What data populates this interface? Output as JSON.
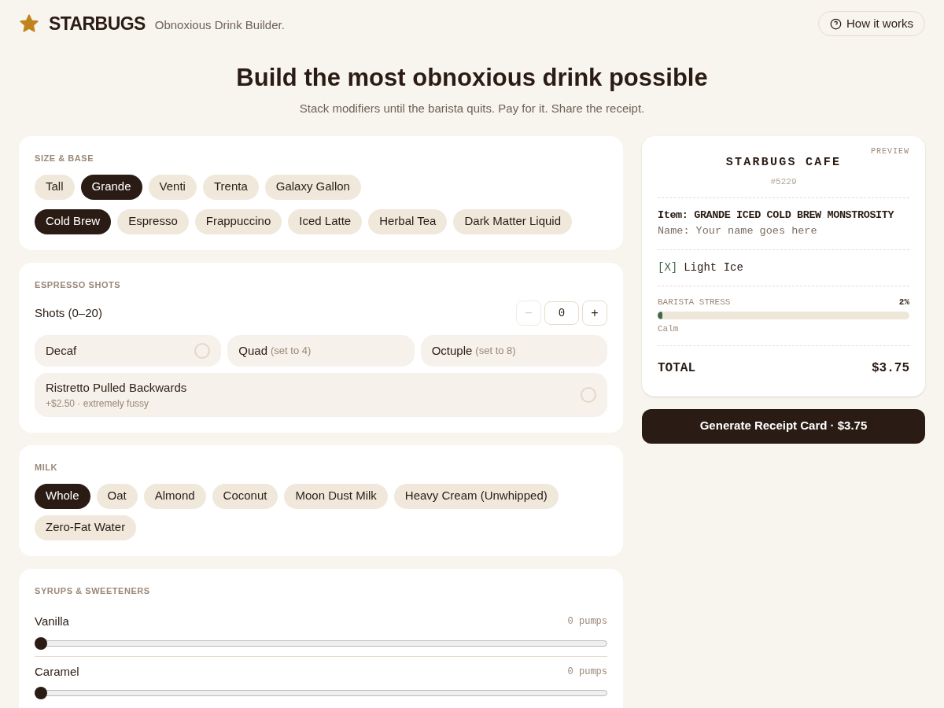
{
  "brand": {
    "name": "STARBUGS",
    "tagline": "Obnoxious Drink Builder."
  },
  "help_button": {
    "label": "How it works"
  },
  "hero": {
    "title": "Build the most obnoxious drink possible",
    "subtitle": "Stack modifiers until the barista quits. Pay for it. Share the receipt."
  },
  "size_base": {
    "heading": "SIZE & BASE",
    "sizes": [
      {
        "label": "Tall",
        "selected": false
      },
      {
        "label": "Grande",
        "selected": true
      },
      {
        "label": "Venti",
        "selected": false
      },
      {
        "label": "Trenta",
        "selected": false
      },
      {
        "label": "Galaxy Gallon",
        "selected": false
      }
    ],
    "bases": [
      {
        "label": "Cold Brew",
        "selected": true
      },
      {
        "label": "Espresso",
        "selected": false
      },
      {
        "label": "Frappuccino",
        "selected": false
      },
      {
        "label": "Iced Latte",
        "selected": false
      },
      {
        "label": "Herbal Tea",
        "selected": false
      },
      {
        "label": "Dark Matter Liquid",
        "selected": false
      }
    ]
  },
  "espresso": {
    "heading": "ESPRESSO SHOTS",
    "shots_label": "Shots (0–20)",
    "minus": "−",
    "shots": "0",
    "plus": "+",
    "options": [
      {
        "kind": "toggle",
        "label": "Decaf",
        "checked": false
      },
      {
        "kind": "preset",
        "label": "Quad",
        "hint": "(set to 4)"
      },
      {
        "kind": "preset",
        "label": "Octuple",
        "hint": "(set to 8)"
      },
      {
        "kind": "toggle",
        "label": "Ristretto Pulled Backwards",
        "detail": "+$2.50 · extremely fussy",
        "checked": false
      }
    ]
  },
  "milk": {
    "heading": "MILK",
    "options": [
      {
        "label": "Whole",
        "selected": true
      },
      {
        "label": "Oat",
        "selected": false
      },
      {
        "label": "Almond",
        "selected": false
      },
      {
        "label": "Coconut",
        "selected": false
      },
      {
        "label": "Moon Dust Milk",
        "selected": false
      },
      {
        "label": "Heavy Cream (Unwhipped)",
        "selected": false
      },
      {
        "label": "Zero-Fat Water",
        "selected": false
      }
    ]
  },
  "syrups": {
    "heading": "SYRUPS & SWEETENERS",
    "items": [
      {
        "name": "Vanilla",
        "reading": "0 pumps",
        "level": 0
      },
      {
        "name": "Caramel",
        "reading": "0 pumps",
        "level": 0
      }
    ]
  },
  "receipt": {
    "badge": "PREVIEW",
    "store": "STARBUGS CAFE",
    "number": "#5229",
    "item_label": "Item:",
    "item": "GRANDE ICED COLD BREW MONSTROSITY",
    "name_line": "Name: Your name goes here",
    "mods": [
      {
        "mark": "[X]",
        "label": "Light Ice"
      }
    ],
    "stress": {
      "label": "BARISTA STRESS",
      "reading": "2%",
      "level": 0.02,
      "mood": "Calm"
    },
    "total_label": "TOTAL",
    "total": "$3.75"
  },
  "generate_button": {
    "label": "Generate Receipt Card · $3.75"
  }
}
